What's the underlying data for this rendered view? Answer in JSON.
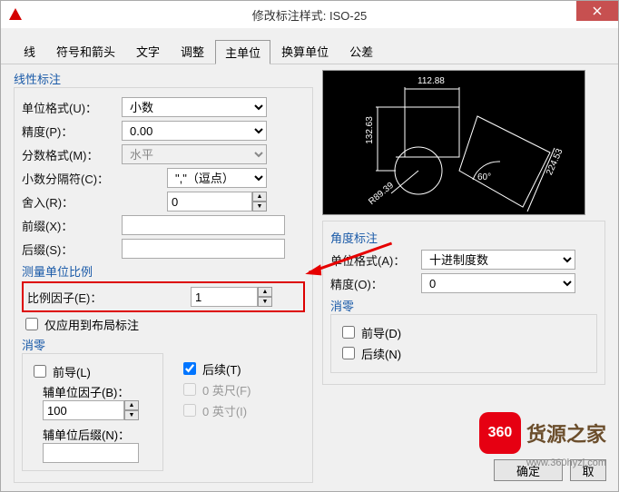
{
  "titlebar": {
    "title": "修改标注样式: ISO-25"
  },
  "tabs": [
    "线",
    "符号和箭头",
    "文字",
    "调整",
    "主单位",
    "换算单位",
    "公差"
  ],
  "active_tab": "主单位",
  "linear": {
    "legend": "线性标注",
    "unit_format_label": "单位格式(U)：",
    "unit_format_value": "小数",
    "precision_label": "精度(P)：",
    "precision_value": "0.00",
    "fraction_label": "分数格式(M)：",
    "fraction_value": "水平",
    "decimal_sep_label": "小数分隔符(C)：",
    "decimal_sep_value": "\",\"（逗点）",
    "round_label": "舍入(R)：",
    "round_value": "0",
    "prefix_label": "前缀(X)：",
    "prefix_value": "",
    "suffix_label": "后缀(S)：",
    "suffix_value": ""
  },
  "scale": {
    "legend": "测量单位比例",
    "factor_label": "比例因子(E)：",
    "factor_value": "1",
    "layout_only": "仅应用到布局标注"
  },
  "zero_supp": {
    "legend": "消零",
    "leading": "前导(L)",
    "trailing": "后续(T)",
    "subunit_factor_label": "辅单位因子(B)：",
    "subunit_factor_value": "100",
    "subunit_suffix_label": "辅单位后缀(N)：",
    "subunit_suffix_value": "",
    "zero_feet": "0 英尺(F)",
    "zero_inch": "0 英寸(I)"
  },
  "angle": {
    "legend": "角度标注",
    "unit_label": "单位格式(A)：",
    "unit_value": "十进制度数",
    "precision_label": "精度(O)：",
    "precision_value": "0",
    "zero_legend": "消零",
    "leading": "前导(D)",
    "trailing": "后续(N)"
  },
  "preview_dims": {
    "a": "112.88",
    "b": "132.63",
    "c": "224.53",
    "d": "60°",
    "r": "R89.39"
  },
  "buttons": {
    "ok": "确定",
    "cancel": "取"
  },
  "watermark": {
    "badge": "360",
    "text": "货源之家",
    "url": "www.360hyzj.com"
  }
}
